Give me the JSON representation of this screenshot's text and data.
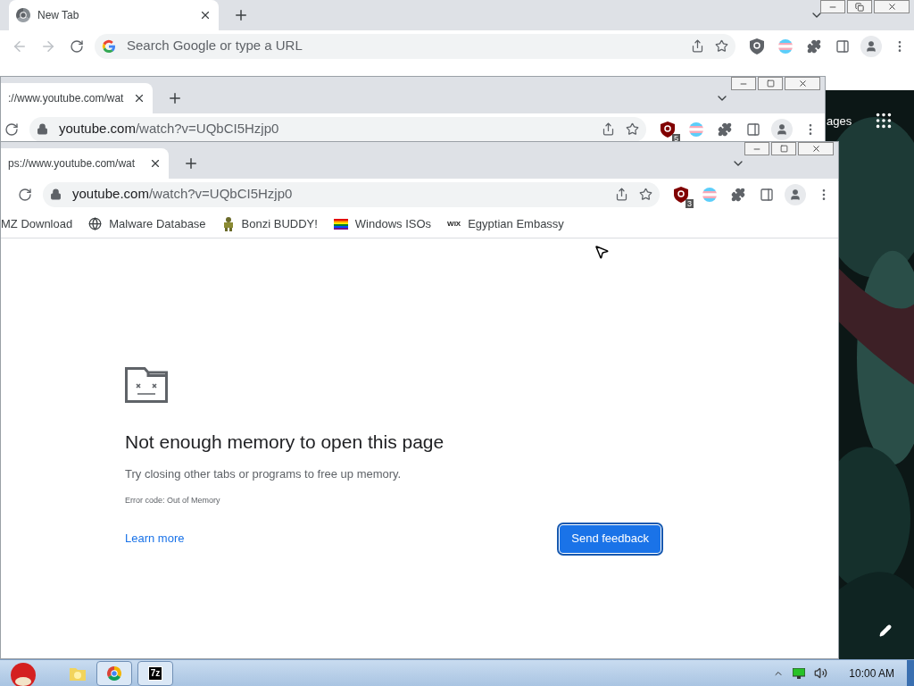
{
  "windows": [
    {
      "maximized": true,
      "tab": {
        "title": "New Tab",
        "favicon": true
      },
      "nav": [
        {
          "kind": "back",
          "disabled": true
        },
        {
          "kind": "forward",
          "disabled": true
        },
        {
          "kind": "reload",
          "disabled": false
        }
      ],
      "address": {
        "placeholder": "Search Google or type a URL"
      },
      "content": {
        "kind": "ntp",
        "link": "ages"
      }
    },
    {
      "maximized": false,
      "tab": {
        "title": "://www.youtube.com/wat"
      },
      "nav": [
        {
          "kind": "reload",
          "disabled": false
        }
      ],
      "address": {
        "host": "youtube.com",
        "path": "/watch?v=UQbCI5Hzjp0"
      },
      "badge": "5"
    },
    {
      "maximized": false,
      "tab": {
        "title": "ps://www.youtube.com/wat"
      },
      "nav": [
        {
          "kind": "reload",
          "disabled": false
        }
      ],
      "address": {
        "host": "youtube.com",
        "path": "/watch?v=UQbCI5Hzjp0"
      },
      "badge": "3",
      "bookmarks": [
        {
          "kind": "cut",
          "label": "MZ Download"
        },
        {
          "kind": "globe",
          "label": "Malware Database"
        },
        {
          "kind": "figure",
          "label": "Bonzi BUDDY!"
        },
        {
          "kind": "rainbow",
          "label": "Windows ISOs"
        },
        {
          "kind": "text",
          "favicon_text": "WIX",
          "label": "Egyptian Embassy"
        }
      ],
      "content": {
        "kind": "error",
        "heading": "Not enough memory to open this page",
        "message": "Try closing other tabs or programs to free up memory.",
        "error_code": "Error code: Out of Memory",
        "link": "Learn more",
        "button": "Send feedback"
      }
    }
  ],
  "taskbar": {
    "buttons": [
      {
        "kind": "folder",
        "running": false
      },
      {
        "kind": "chrome",
        "running": true
      },
      {
        "kind": "sevenzip",
        "label": "7z",
        "running": true
      }
    ],
    "clock": "10:00 AM"
  }
}
